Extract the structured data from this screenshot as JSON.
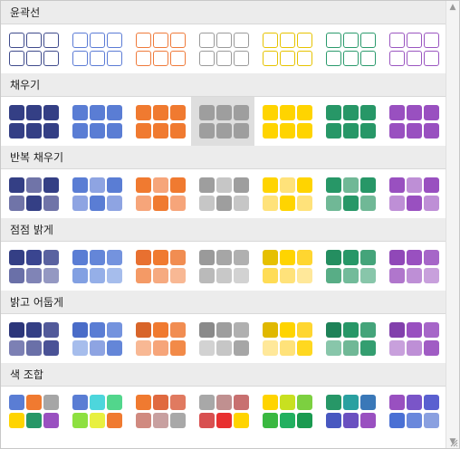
{
  "sections": [
    {
      "title": "윤곽선",
      "style": "outline",
      "swatches": [
        [
          "#3f4b8c",
          "#3f4b8c",
          "#3f4b8c",
          "#3f4b8c",
          "#3f4b8c",
          "#3f4b8c"
        ],
        [
          "#5b7bd5",
          "#5b7bd5",
          "#5b7bd5",
          "#5b7bd5",
          "#5b7bd5",
          "#5b7bd5"
        ],
        [
          "#ef7a3a",
          "#ef7a3a",
          "#ef7a3a",
          "#ef7a3a",
          "#ef7a3a",
          "#ef7a3a"
        ],
        [
          "#9a9a9a",
          "#9a9a9a",
          "#9a9a9a",
          "#9a9a9a",
          "#9a9a9a",
          "#9a9a9a"
        ],
        [
          "#e6c300",
          "#e6c300",
          "#e6c300",
          "#e6c300",
          "#e6c300",
          "#e6c300"
        ],
        [
          "#2a9a6c",
          "#2a9a6c",
          "#2a9a6c",
          "#2a9a6c",
          "#2a9a6c",
          "#2a9a6c"
        ],
        [
          "#9a55c0",
          "#9a55c0",
          "#9a55c0",
          "#9a55c0",
          "#9a55c0",
          "#9a55c0"
        ]
      ]
    },
    {
      "title": "채우기",
      "style": "fill",
      "hover_index": 3,
      "swatches": [
        [
          "#343f85",
          "#343f85",
          "#343f85",
          "#343f85",
          "#343f85",
          "#343f85"
        ],
        [
          "#5a7dd4",
          "#5a7dd4",
          "#5a7dd4",
          "#5a7dd4",
          "#5a7dd4",
          "#5a7dd4"
        ],
        [
          "#f07a30",
          "#f07a30",
          "#f07a30",
          "#f07a30",
          "#f07a30",
          "#f07a30"
        ],
        [
          "#9e9e9e",
          "#9e9e9e",
          "#9e9e9e",
          "#9e9e9e",
          "#9e9e9e",
          "#9e9e9e"
        ],
        [
          "#ffd400",
          "#ffd400",
          "#ffd400",
          "#ffd400",
          "#ffd400",
          "#ffd400"
        ],
        [
          "#279767",
          "#279767",
          "#279767",
          "#279767",
          "#279767",
          "#279767"
        ],
        [
          "#9950c0",
          "#9950c0",
          "#9950c0",
          "#9950c0",
          "#9950c0",
          "#9950c0"
        ]
      ]
    },
    {
      "title": "반복 채우기",
      "style": "fill",
      "swatches": [
        [
          "#343f85",
          "#7074a8",
          "#343f85",
          "#7074a8",
          "#343f85",
          "#7074a8"
        ],
        [
          "#5a7dd4",
          "#8ea4e2",
          "#5a7dd4",
          "#8ea4e2",
          "#5a7dd4",
          "#8ea4e2"
        ],
        [
          "#f07a30",
          "#f6a57a",
          "#f07a30",
          "#f6a57a",
          "#f07a30",
          "#f6a57a"
        ],
        [
          "#9e9e9e",
          "#c6c6c6",
          "#9e9e9e",
          "#c6c6c6",
          "#9e9e9e",
          "#c6c6c6"
        ],
        [
          "#ffd400",
          "#ffe27a",
          "#ffd400",
          "#ffe27a",
          "#ffd400",
          "#ffe27a"
        ],
        [
          "#279767",
          "#70b896",
          "#279767",
          "#70b896",
          "#279767",
          "#70b896"
        ],
        [
          "#9950c0",
          "#be8fd6",
          "#9950c0",
          "#be8fd6",
          "#9950c0",
          "#be8fd6"
        ]
      ]
    },
    {
      "title": "점점 밝게",
      "style": "fill",
      "swatches": [
        [
          "#343f85",
          "#3a4590",
          "#5a62a0",
          "#6a70a8",
          "#8084b6",
          "#9498c2"
        ],
        [
          "#5a7dd4",
          "#6486d8",
          "#7493de",
          "#82a0e2",
          "#95afe8",
          "#a6bdec"
        ],
        [
          "#e87030",
          "#f07a30",
          "#f18d52",
          "#f49a66",
          "#f6aa80",
          "#f8b894"
        ],
        [
          "#9a9a9a",
          "#a6a6a6",
          "#b0b0b0",
          "#bababa",
          "#c8c8c8",
          "#d2d2d2"
        ],
        [
          "#e6c000",
          "#ffd400",
          "#ffd630",
          "#ffdc55",
          "#ffe27a",
          "#ffe89a"
        ],
        [
          "#248e60",
          "#279767",
          "#44a47a",
          "#58ad86",
          "#72bb9a",
          "#88c6aa"
        ],
        [
          "#9048b8",
          "#9950c0",
          "#a666c8",
          "#b076cc",
          "#be8fd6",
          "#c8a0dc"
        ]
      ]
    },
    {
      "title": "밝고 어둡게",
      "style": "fill",
      "swatches": [
        [
          "#2c367a",
          "#343f85",
          "#525a9a",
          "#7c80b4",
          "#6a70a8",
          "#4a5296"
        ],
        [
          "#4a6cc8",
          "#5a7dd4",
          "#7493de",
          "#a6bdec",
          "#8ea4e2",
          "#6486d8"
        ],
        [
          "#d8652a",
          "#f07a30",
          "#f18d52",
          "#f8b894",
          "#f6a57a",
          "#f28a48"
        ],
        [
          "#8a8a8a",
          "#9e9e9e",
          "#b0b0b0",
          "#d2d2d2",
          "#c6c6c6",
          "#a6a6a6"
        ],
        [
          "#e0b800",
          "#ffd400",
          "#ffd630",
          "#ffe89a",
          "#ffe27a",
          "#ffd820"
        ],
        [
          "#1e8258",
          "#279767",
          "#44a47a",
          "#88c6aa",
          "#70b896",
          "#349e70"
        ],
        [
          "#8240ac",
          "#9950c0",
          "#a666c8",
          "#c8a0dc",
          "#be8fd6",
          "#a05cc4"
        ]
      ]
    },
    {
      "title": "색 조합",
      "style": "fill",
      "swatches": [
        [
          "#5a7dd4",
          "#f07a30",
          "#a6a6a6",
          "#ffd400",
          "#279767",
          "#9950c0"
        ],
        [
          "#5a7dd4",
          "#4dd6dc",
          "#52d68c",
          "#8de040",
          "#e8f040",
          "#f07a30"
        ],
        [
          "#f07a30",
          "#e06a40",
          "#e07a60",
          "#d08a80",
          "#c8a0a0",
          "#a8a8a8"
        ],
        [
          "#a8a8a8",
          "#c09090",
          "#c87070",
          "#d85050",
          "#e83030",
          "#ffd400"
        ],
        [
          "#ffd400",
          "#c8e020",
          "#7cd040",
          "#3ab840",
          "#22b060",
          "#1a9a50"
        ],
        [
          "#279767",
          "#2aa0a0",
          "#3a78b8",
          "#4858c0",
          "#6a50c0",
          "#9950c0"
        ],
        [
          "#9950c0",
          "#7a55c8",
          "#5a60d0",
          "#4a70d4",
          "#6a88dc",
          "#8aa0e0"
        ]
      ]
    }
  ]
}
